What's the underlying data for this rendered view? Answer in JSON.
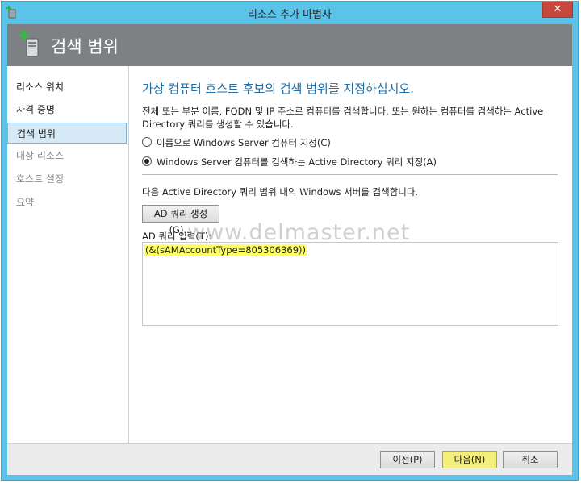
{
  "window": {
    "title": "리소스 추가 마법사",
    "close_glyph": "✕"
  },
  "header": {
    "title": "검색 범위",
    "icon": "server-add-icon"
  },
  "sidebar": {
    "items": [
      {
        "label": "리소스 위치",
        "state": "normal"
      },
      {
        "label": "자격 증명",
        "state": "normal"
      },
      {
        "label": "검색 범위",
        "state": "selected"
      },
      {
        "label": "대상 리소스",
        "state": "disabled"
      },
      {
        "label": "호스트 설정",
        "state": "disabled"
      },
      {
        "label": "요약",
        "state": "disabled"
      }
    ]
  },
  "main": {
    "title": "가상 컴퓨터 호스트 후보의 검색 범위를 지정하십시오.",
    "description": "전체 또는 부분 이름, FQDN 및 IP 주소로 컴퓨터를 검색합니다. 또는 원하는 컴퓨터를 검색하는 Active Directory 쿼리를 생성할 수 있습니다.",
    "radio_name": "이름으로 Windows Server 컴퓨터 지정(C)",
    "radio_ad": "Windows Server 컴퓨터를 검색하는 Active Directory 쿼리 지정(A)",
    "search_info": "다음 Active Directory 쿼리 범위 내의 Windows 서버를 검색합니다.",
    "gen_button": "AD 쿼리 생성(G)...",
    "query_label": "AD 쿼리 입력(T):",
    "query_value": "(&(sAMAccountType=805306369))"
  },
  "watermark": "www.delmaster.net",
  "footer": {
    "back": "이전(P)",
    "next": "다음(N)",
    "cancel": "취소"
  },
  "colors": {
    "titlebar": "#5bc3e8",
    "header": "#7e8184",
    "accent_title": "#1e6fa8",
    "selected_nav": "#d5e9f7",
    "primary_button": "#f3ef7a",
    "query_highlight": "#ffff66"
  }
}
